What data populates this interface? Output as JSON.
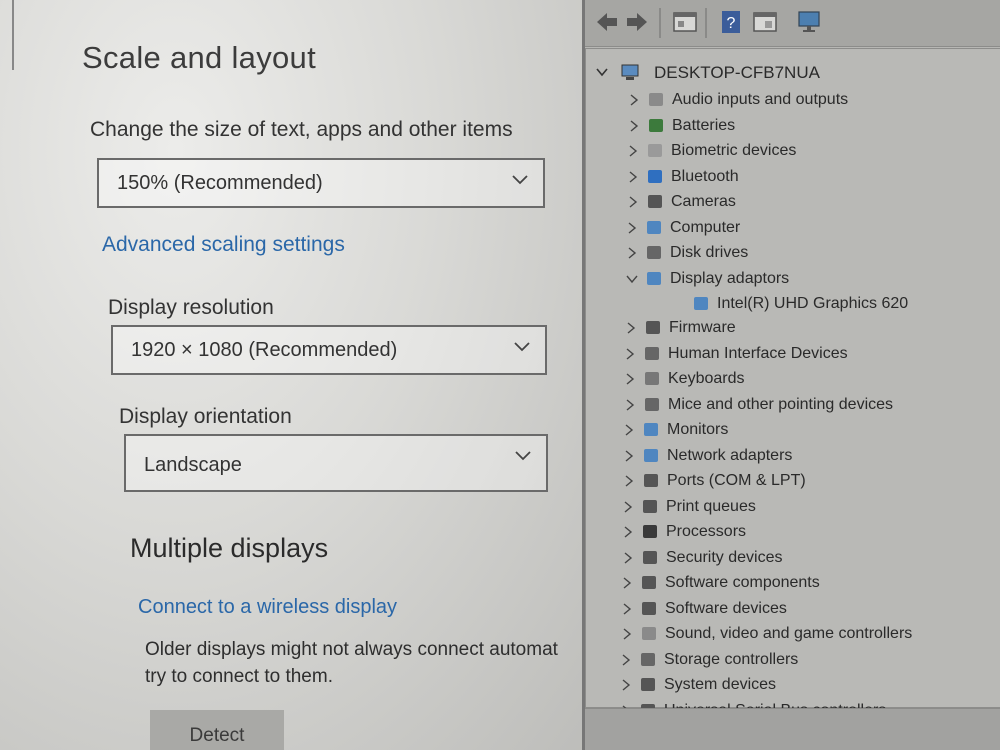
{
  "settings": {
    "heading": "Scale and layout",
    "scale_label": "Change the size of text, apps and other items",
    "scale_value": "150% (Recommended)",
    "advanced_link": "Advanced scaling settings",
    "resolution_label": "Display resolution",
    "resolution_value": "1920 × 1080 (Recommended)",
    "orientation_label": "Display orientation",
    "orientation_value": "Landscape",
    "multiple_heading": "Multiple displays",
    "wireless_link": "Connect to a wireless display",
    "older_line1": "Older displays might not always connect automat",
    "older_line2": "try to connect to them.",
    "detect_button": "Detect"
  },
  "device_manager": {
    "toolbar": [
      "back-arrow-icon",
      "forward-arrow-icon",
      "properties-icon",
      "help-icon",
      "update-driver-icon",
      "monitor-icon"
    ],
    "root": "DESKTOP-CFB7NUA",
    "items": [
      {
        "label": "Audio inputs and outputs",
        "icon": "speaker-icon",
        "expanded": false
      },
      {
        "label": "Batteries",
        "icon": "battery-icon",
        "expanded": false
      },
      {
        "label": "Biometric devices",
        "icon": "fingerprint-icon",
        "expanded": false
      },
      {
        "label": "Bluetooth",
        "icon": "bluetooth-icon",
        "expanded": false
      },
      {
        "label": "Cameras",
        "icon": "camera-icon",
        "expanded": false
      },
      {
        "label": "Computer",
        "icon": "computer-icon",
        "expanded": false
      },
      {
        "label": "Disk drives",
        "icon": "disk-icon",
        "expanded": false
      },
      {
        "label": "Display adaptors",
        "icon": "display-adapter-icon",
        "expanded": true
      },
      {
        "label": "Intel(R) UHD Graphics 620",
        "icon": "display-adapter-icon",
        "child": true
      },
      {
        "label": "Firmware",
        "icon": "chip-icon",
        "expanded": false
      },
      {
        "label": "Human Interface Devices",
        "icon": "hid-icon",
        "expanded": false
      },
      {
        "label": "Keyboards",
        "icon": "keyboard-icon",
        "expanded": false
      },
      {
        "label": "Mice and other pointing devices",
        "icon": "mouse-icon",
        "expanded": false
      },
      {
        "label": "Monitors",
        "icon": "monitor-icon",
        "expanded": false
      },
      {
        "label": "Network adapters",
        "icon": "network-icon",
        "expanded": false
      },
      {
        "label": "Ports (COM & LPT)",
        "icon": "port-icon",
        "expanded": false
      },
      {
        "label": "Print queues",
        "icon": "printer-icon",
        "expanded": false
      },
      {
        "label": "Processors",
        "icon": "processor-icon",
        "expanded": false
      },
      {
        "label": "Security devices",
        "icon": "security-icon",
        "expanded": false
      },
      {
        "label": "Software components",
        "icon": "software-icon",
        "expanded": false
      },
      {
        "label": "Software devices",
        "icon": "software-icon",
        "expanded": false
      },
      {
        "label": "Sound, video and game controllers",
        "icon": "speaker-icon",
        "expanded": false
      },
      {
        "label": "Storage controllers",
        "icon": "storage-icon",
        "expanded": false
      },
      {
        "label": "System devices",
        "icon": "system-icon",
        "expanded": false
      },
      {
        "label": "Universal Serial Bus controllers",
        "icon": "usb-icon",
        "expanded": false
      }
    ]
  }
}
